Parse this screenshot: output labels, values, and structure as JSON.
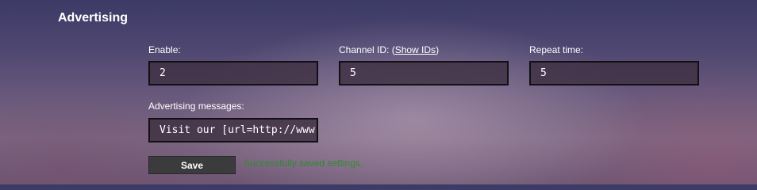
{
  "section": {
    "title": "Advertising"
  },
  "fields": {
    "enable": {
      "label": "Enable:",
      "value": "2"
    },
    "channel_id": {
      "label_prefix": "Channel ID: (",
      "link_text": "Show IDs",
      "label_suffix": ")",
      "value": "5"
    },
    "repeat_time": {
      "label": "Repeat time:",
      "value": "5"
    },
    "advertising_messages": {
      "label": "Advertising messages:",
      "value": "Visit our [url=http://www.hom"
    }
  },
  "actions": {
    "save_label": "Save",
    "status_message": "Successfully saved settings."
  },
  "colors": {
    "status_success": "#2f8a2f",
    "input_background": "#3e3042",
    "input_border": "#121015",
    "button_background": "#3b3a3d"
  }
}
